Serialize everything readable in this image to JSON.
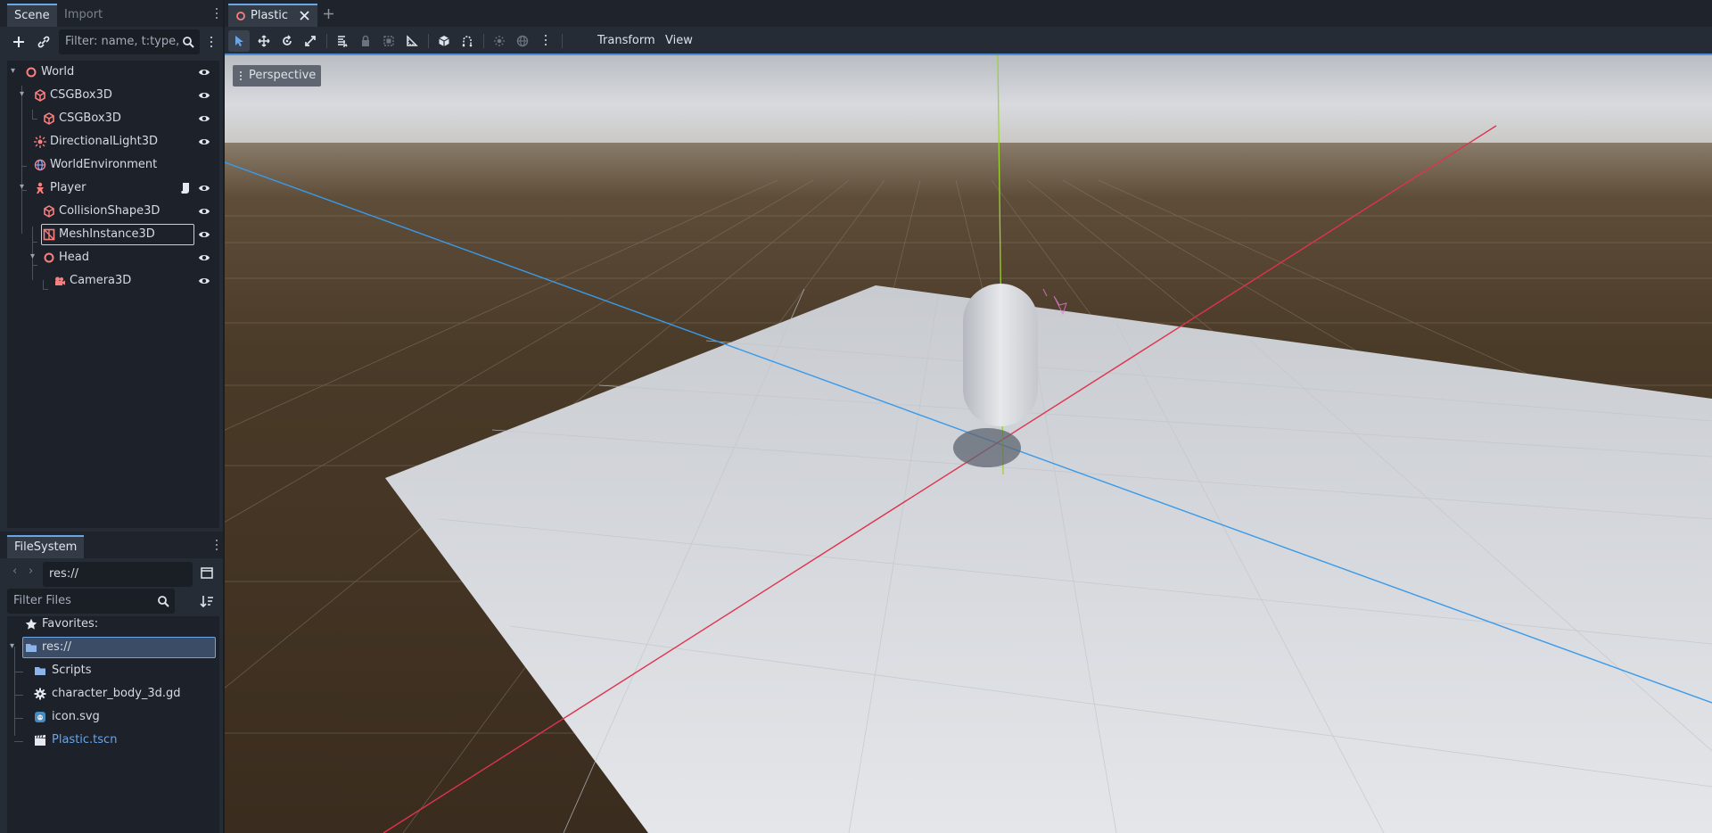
{
  "scene_dock": {
    "tabs": [
      "Scene",
      "Import"
    ],
    "filter_placeholder": "Filter: name, t:type,",
    "tree": [
      {
        "label": "World",
        "icon": "node3d-icon",
        "visible_toggle": true
      },
      {
        "label": "CSGBox3D",
        "icon": "csgbox-icon",
        "visible_toggle": true
      },
      {
        "label": "CSGBox3D",
        "icon": "csgbox-icon",
        "visible_toggle": true
      },
      {
        "label": "DirectionalLight3D",
        "icon": "light-icon",
        "visible_toggle": true
      },
      {
        "label": "WorldEnvironment",
        "icon": "globe-icon",
        "visible_toggle": false
      },
      {
        "label": "Player",
        "icon": "character-icon",
        "visible_toggle": true,
        "has_script": true
      },
      {
        "label": "CollisionShape3D",
        "icon": "collision-icon",
        "visible_toggle": true
      },
      {
        "label": "MeshInstance3D",
        "icon": "mesh-icon",
        "visible_toggle": true,
        "selected": true
      },
      {
        "label": "Head",
        "icon": "node3d-icon",
        "visible_toggle": true
      },
      {
        "label": "Camera3D",
        "icon": "camera-icon",
        "visible_toggle": true
      }
    ]
  },
  "filesystem_dock": {
    "tab": "FileSystem",
    "path": "res://",
    "filter_placeholder": "Filter Files",
    "favorites_label": "Favorites:",
    "root_label": "res://",
    "items": [
      {
        "label": "Scripts",
        "icon": "folder-icon"
      },
      {
        "label": "character_body_3d.gd",
        "icon": "gear-icon"
      },
      {
        "label": "icon.svg",
        "icon": "image-icon"
      },
      {
        "label": "Plastic.tscn",
        "icon": "clapper-icon",
        "highlight": true
      }
    ]
  },
  "editor": {
    "scene_tab": "Plastic",
    "menus": [
      "Transform",
      "View"
    ],
    "viewport_mode": "Perspective"
  },
  "colors": {
    "accent": "#6aa5e6",
    "node_red": "#fc7f7f",
    "axis_x": "#e0334e",
    "axis_y": "#9ad32e",
    "axis_z": "#3a9ae8"
  }
}
